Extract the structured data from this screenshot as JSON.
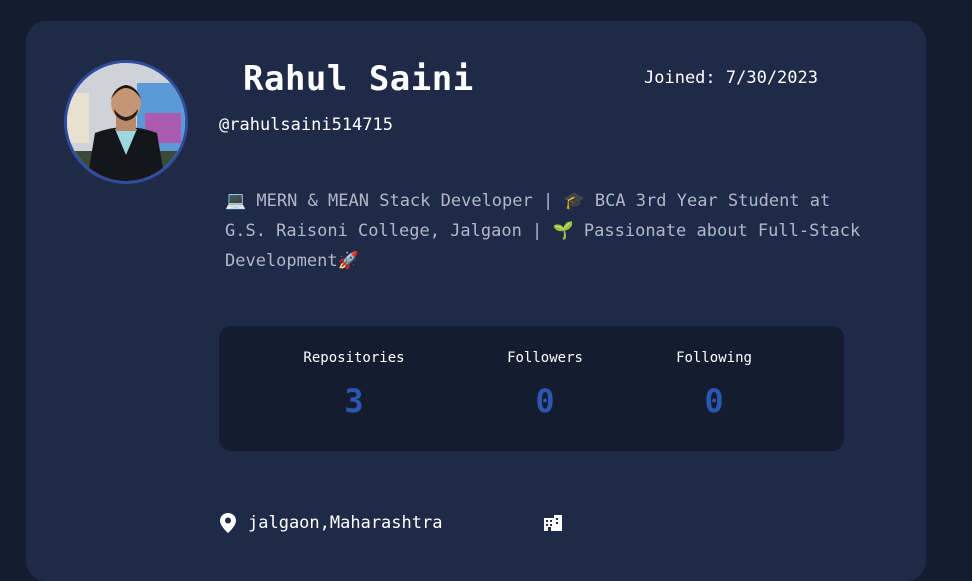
{
  "profile": {
    "name": "Rahul Saini",
    "joined": "Joined: 7/30/2023",
    "handle": "@rahulsaini514715",
    "bio": "💻 MERN & MEAN Stack Developer | 🎓 BCA 3rd Year Student at G.S. Raisoni College, Jalgaon | 🌱 Passionate about Full-Stack Development🚀",
    "avatar_icon": "user-photo"
  },
  "stats": {
    "repositories_label": "Repositories",
    "repositories_value": "3",
    "followers_label": "Followers",
    "followers_value": "0",
    "following_label": "Following",
    "following_value": "0"
  },
  "details": {
    "location": "jalgaon,Maharashtra",
    "location_icon": "map-pin-icon",
    "company_icon": "building-icon"
  },
  "colors": {
    "page_bg": "#141d2f",
    "card_bg": "#1f2a48",
    "accent": "#2d56b3",
    "text": "#ffffff",
    "muted": "#b0b8c8"
  }
}
